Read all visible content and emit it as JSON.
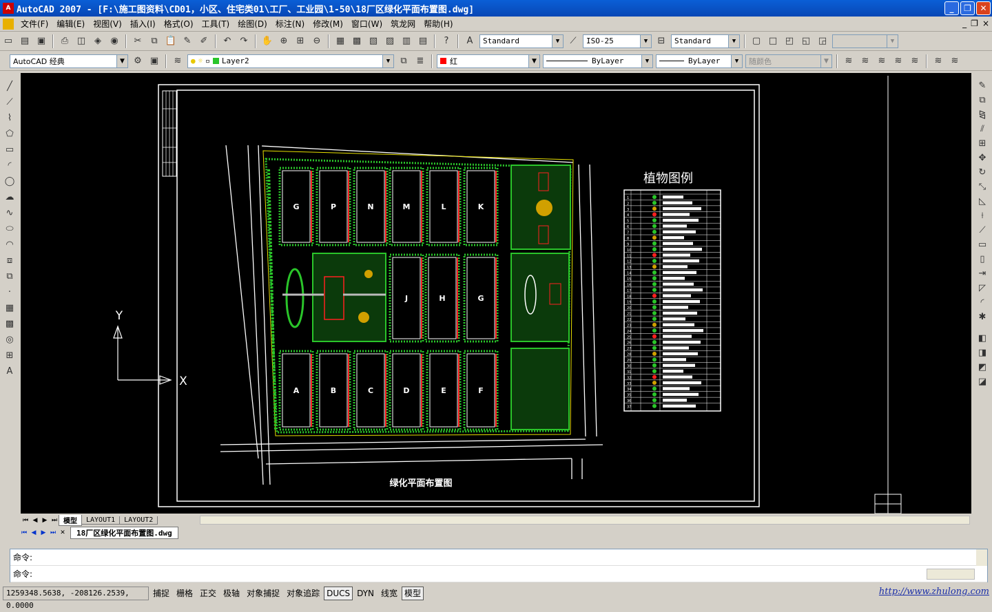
{
  "window": {
    "app_icon": "autocad-icon",
    "title": "AutoCAD 2007 - [F:\\施工图资料\\CD01，小区、住宅类01\\工厂、工业园\\1-50\\18厂区绿化平面布置图.dwg]",
    "minimize": "_",
    "restore": "❐",
    "close": "✕"
  },
  "menu": {
    "items": [
      "文件(F)",
      "编辑(E)",
      "视图(V)",
      "插入(I)",
      "格式(O)",
      "工具(T)",
      "绘图(D)",
      "标注(N)",
      "修改(M)",
      "窗口(W)",
      "筑龙网",
      "帮助(H)"
    ],
    "mdi_minimize": "_",
    "mdi_restore": "❐",
    "mdi_close": "×"
  },
  "toolbar1": {
    "text_style": "Standard",
    "dim_style": "ISO-25",
    "table_style": "Standard",
    "extra": ""
  },
  "toolbar2": {
    "workspace": "AutoCAD 经典",
    "layer": "Layer2",
    "color": "红",
    "linetype": "ByLayer",
    "lineweight": "ByLayer",
    "plotstyle": "随颜色"
  },
  "drawing": {
    "title": "绿化平面布置图",
    "legend_title": "植物图例",
    "axis_y": "Y",
    "axis_x": "X",
    "blocks_top": [
      "G",
      "P",
      "N",
      "M",
      "L",
      "K"
    ],
    "blocks_mid": [
      "J",
      "H",
      "G"
    ],
    "blocks_bottom": [
      "A",
      "B",
      "C",
      "D",
      "E",
      "F"
    ],
    "legend_rows": [
      "1",
      "2",
      "3",
      "4",
      "5",
      "6",
      "7",
      "8",
      "9",
      "10",
      "11",
      "12",
      "13",
      "14",
      "15",
      "16",
      "17",
      "18",
      "19",
      "20",
      "21",
      "22",
      "23",
      "24",
      "25",
      "26",
      "27",
      "28",
      "29",
      "30",
      "31",
      "32",
      "33",
      "34",
      "35",
      "36",
      "37"
    ]
  },
  "layout_tabs": [
    "模型",
    "LAYOUT1",
    "LAYOUT2"
  ],
  "doc_tab": "18厂区绿化平面布置图.dwg",
  "command": {
    "line1": "命令:",
    "line2": "命令:"
  },
  "status": {
    "coords": "1259348.5638, -208126.2539, 0.0000",
    "buttons": [
      "捕捉",
      "栅格",
      "正交",
      "极轴",
      "对象捕捉",
      "对象追踪",
      "DUCS",
      "DYN",
      "线宽",
      "模型"
    ],
    "on": [
      "DUCS",
      "模型"
    ],
    "watermark": "http://www.zhulong.com"
  },
  "colors": {
    "titlebar": "#0846b5",
    "canvas": "#000000",
    "green_plants": "#1fa31f",
    "red_lines": "#ff2020",
    "cyan_lines": "#00c8c8"
  }
}
